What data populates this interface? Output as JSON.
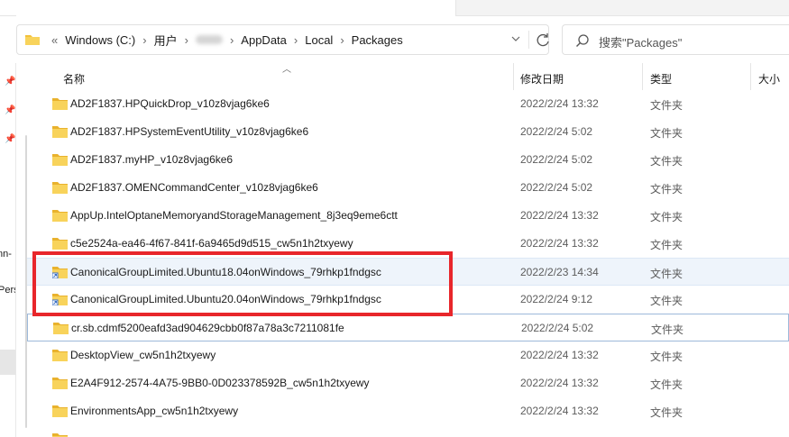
{
  "address": {
    "overflow": "«",
    "crumbs": [
      "Windows (C:)",
      "用户",
      "AppData",
      "Local",
      "Packages"
    ],
    "separator": "›",
    "dropdown_icon": "chevron-down-icon",
    "refresh_icon": "refresh-icon"
  },
  "search": {
    "placeholder": "搜索\"Packages\""
  },
  "nav": {
    "partial_labels": [
      "nn-",
      "Pers"
    ]
  },
  "columns": {
    "name": "名称",
    "modified": "修改日期",
    "type": "类型",
    "size": "大小"
  },
  "files": [
    {
      "name": "AD2F1837.HPQuickDrop_v10z8vjag6ke6",
      "date": "2022/2/24 13:32",
      "type": "文件夹"
    },
    {
      "name": "AD2F1837.HPSystemEventUtility_v10z8vjag6ke6",
      "date": "2022/2/24 5:02",
      "type": "文件夹"
    },
    {
      "name": "AD2F1837.myHP_v10z8vjag6ke6",
      "date": "2022/2/24 5:02",
      "type": "文件夹"
    },
    {
      "name": "AD2F1837.OMENCommandCenter_v10z8vjag6ke6",
      "date": "2022/2/24 5:02",
      "type": "文件夹"
    },
    {
      "name": "AppUp.IntelOptaneMemoryandStorageManagement_8j3eq9eme6ctt",
      "date": "2022/2/24 13:32",
      "type": "文件夹"
    },
    {
      "name": "c5e2524a-ea46-4f67-841f-6a9465d9d515_cw5n1h2txyewy",
      "date": "2022/2/24 13:32",
      "type": "文件夹"
    },
    {
      "name": "CanonicalGroupLimited.Ubuntu18.04onWindows_79rhkp1fndgsc",
      "date": "2022/2/23 14:34",
      "type": "文件夹"
    },
    {
      "name": "CanonicalGroupLimited.Ubuntu20.04onWindows_79rhkp1fndgsc",
      "date": "2022/2/24 9:12",
      "type": "文件夹"
    },
    {
      "name": "cr.sb.cdmf5200eafd3ad904629cbb0f87a78a3c7211081fe",
      "date": "2022/2/24 5:02",
      "type": "文件夹"
    },
    {
      "name": "DesktopView_cw5n1h2txyewy",
      "date": "2022/2/24 13:32",
      "type": "文件夹"
    },
    {
      "name": "E2A4F912-2574-4A75-9BB0-0D023378592B_cw5n1h2txyewy",
      "date": "2022/2/24 13:32",
      "type": "文件夹"
    },
    {
      "name": "EnvironmentsApp_cw5n1h2txyewy",
      "date": "2022/2/24 13:32",
      "type": "文件夹"
    }
  ],
  "colors": {
    "highlight": "#e8262b",
    "folder": "#f3c13a",
    "selection": "#eef4fb"
  }
}
